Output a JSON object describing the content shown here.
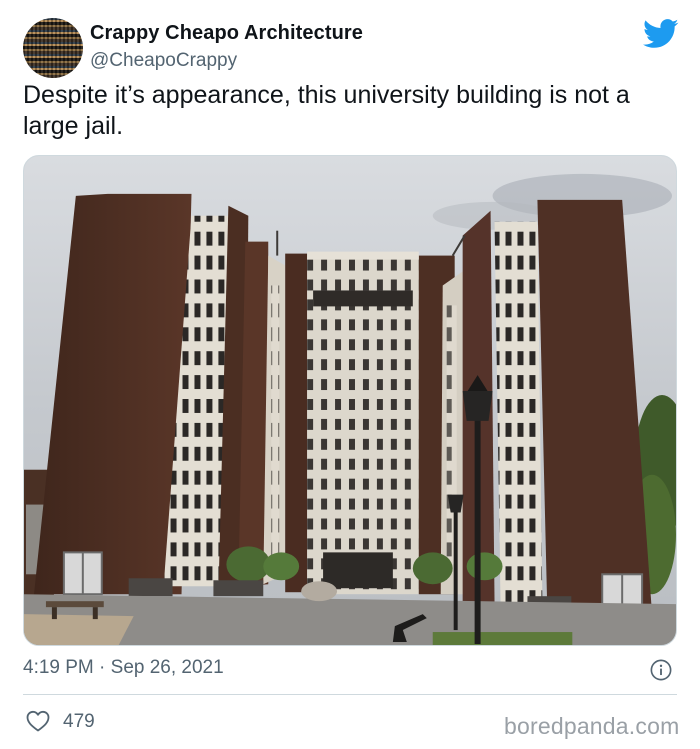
{
  "tweet": {
    "author": {
      "display_name": "Crappy Cheapo Architecture",
      "handle": "@CheapoCrappy",
      "avatar_icon": "brick-pattern-avatar"
    },
    "brand_icon": "twitter-bird-icon",
    "text": "Despite it’s appearance, this university building is not a large jail.",
    "photo": {
      "subject": "brick-and-concrete-university-building-photo"
    },
    "timestamp": "4:19 PM · Sep 26, 2021",
    "info_icon": "info-icon",
    "likes": {
      "icon": "heart-icon",
      "count": "479"
    }
  },
  "watermark": "boredpanda.com",
  "colors": {
    "text_primary": "#0f1419",
    "text_secondary": "#536471",
    "twitter_blue": "#1d9bf0",
    "divider": "#cfd9de",
    "watermark": "#9aa0a6",
    "brick": "#4e2f22",
    "concrete": "#d6d1c6"
  }
}
